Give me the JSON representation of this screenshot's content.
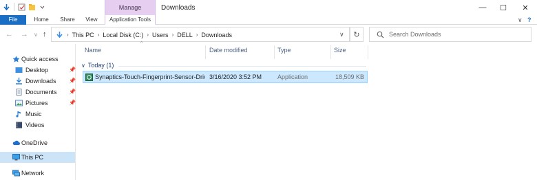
{
  "window": {
    "context_group": "Manage",
    "title": "Downloads",
    "controls": {
      "minimize": "—",
      "maximize": "☐",
      "close": "✕"
    }
  },
  "ribbon": {
    "tabs": [
      "File",
      "Home",
      "Share",
      "View",
      "Application Tools"
    ],
    "expand_glyph": "∨",
    "help_glyph": "?"
  },
  "address": {
    "back": "←",
    "forward": "→",
    "recent": "∨",
    "up": "↑",
    "crumbs": [
      "This PC",
      "Local Disk (C:)",
      "Users",
      "DELL",
      "Downloads"
    ],
    "crumb_sep": "›",
    "dropdown": "∨",
    "refresh": "↻"
  },
  "search": {
    "placeholder": "Search Downloads"
  },
  "nav": {
    "items": [
      {
        "label": "Quick access",
        "icon": "star-icon"
      },
      {
        "label": "Desktop",
        "icon": "desktop-folder-icon",
        "pinned": true
      },
      {
        "label": "Downloads",
        "icon": "downloads-folder-icon",
        "pinned": true
      },
      {
        "label": "Documents",
        "icon": "documents-folder-icon",
        "pinned": true
      },
      {
        "label": "Pictures",
        "icon": "pictures-folder-icon",
        "pinned": true
      },
      {
        "label": "Music",
        "icon": "music-icon"
      },
      {
        "label": "Videos",
        "icon": "videos-icon"
      },
      {
        "label": "OneDrive",
        "icon": "cloud-icon"
      },
      {
        "label": "This PC",
        "icon": "computer-icon",
        "selected": true
      },
      {
        "label": "Network",
        "icon": "network-icon"
      }
    ],
    "pin_glyph": "📌"
  },
  "columns": [
    "Name",
    "Date modified",
    "Type",
    "Size"
  ],
  "group": {
    "label": "Today (1)",
    "chevron": "∨"
  },
  "files": [
    {
      "name": "Synaptics-Touch-Fingerprint-Sensor-Driv...",
      "date": "3/16/2020 3:52 PM",
      "type": "Application",
      "size": "18,509 KB"
    }
  ],
  "colors": {
    "accent": "#1a6fc4",
    "context_tab": "#e6cef0",
    "selection": "#cce8ff"
  }
}
